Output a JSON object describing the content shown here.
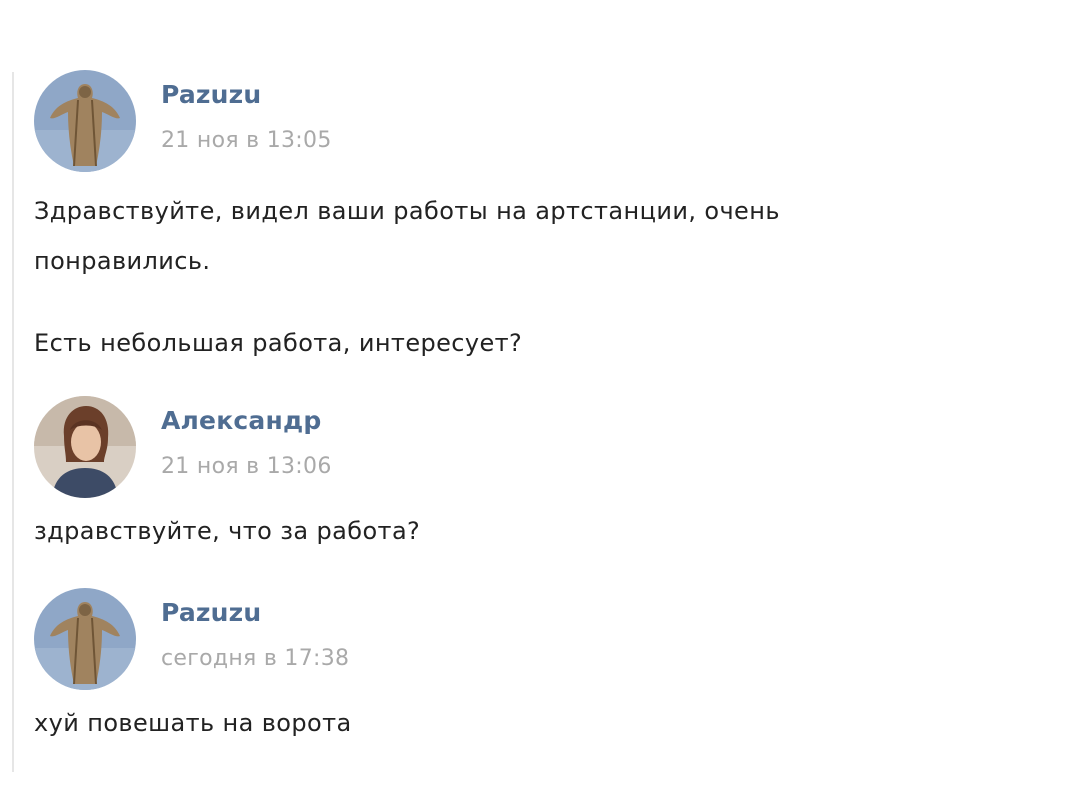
{
  "messages": [
    {
      "author": "Pazuzu",
      "time": "21 ноя в 13:05",
      "avatar_icon": "statue-avatar",
      "lines": [
        "Здравствуйте, видел ваши работы на артстанции, очень",
        "понравились.",
        "Есть небольшая работа, интересует?"
      ]
    },
    {
      "author": "Александр",
      "time": "21 ноя в 13:06",
      "avatar_icon": "person-avatar",
      "lines": [
        "здравствуйте, что за работа?"
      ]
    },
    {
      "author": "Pazuzu",
      "time": "сегодня в 17:38",
      "avatar_icon": "statue-avatar",
      "lines": [
        "хуй повешать на ворота"
      ]
    }
  ],
  "colors": {
    "author": "#4f6d92",
    "time": "#a9a9a9",
    "text": "#222222"
  }
}
